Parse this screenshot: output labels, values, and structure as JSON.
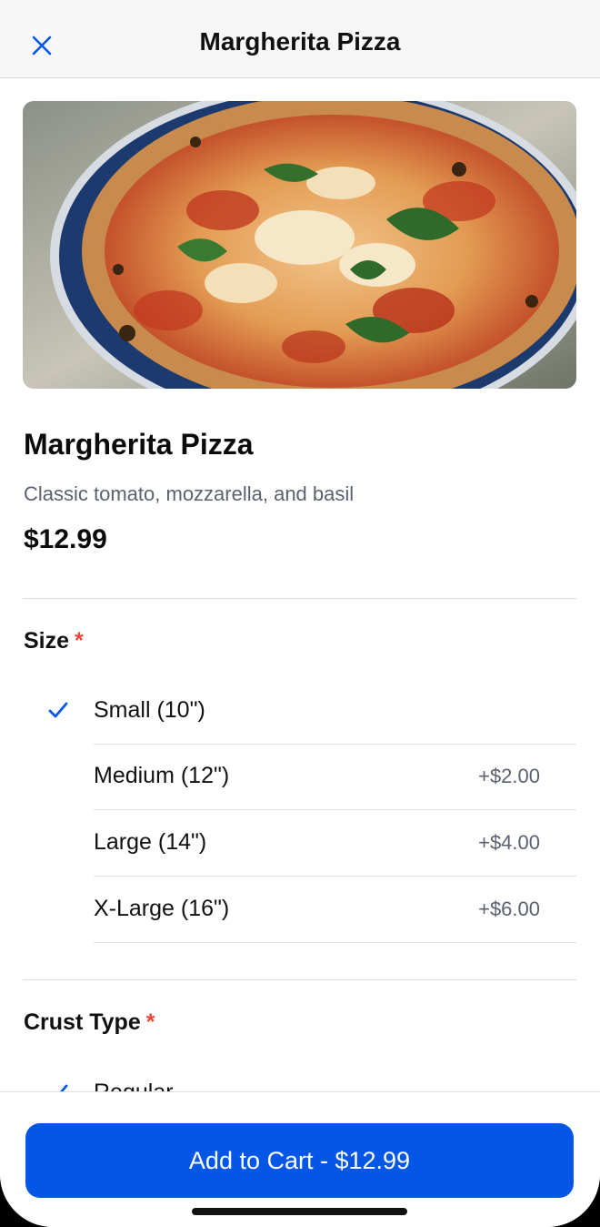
{
  "header": {
    "title": "Margherita Pizza",
    "close_icon": "close-icon"
  },
  "item": {
    "name": "Margherita Pizza",
    "description": "Classic tomato, mozzarella, and basil",
    "price": "$12.99",
    "image": "pizza-photo"
  },
  "sections": {
    "size": {
      "title": "Size",
      "required_mark": "*",
      "options": [
        {
          "label": "Small (10\")",
          "price": "",
          "selected": true
        },
        {
          "label": "Medium (12\")",
          "price": "+$2.00",
          "selected": false
        },
        {
          "label": "Large (14\")",
          "price": "+$4.00",
          "selected": false
        },
        {
          "label": "X-Large (16\")",
          "price": "+$6.00",
          "selected": false
        }
      ]
    },
    "crust": {
      "title": "Crust Type",
      "required_mark": "*",
      "options": [
        {
          "label": "Regular",
          "price": "",
          "selected": true
        }
      ]
    }
  },
  "cart": {
    "button_label": "Add to Cart - $12.99"
  },
  "colors": {
    "accent": "#0457e6",
    "required": "#e5483a",
    "muted_text": "#5b6170"
  }
}
